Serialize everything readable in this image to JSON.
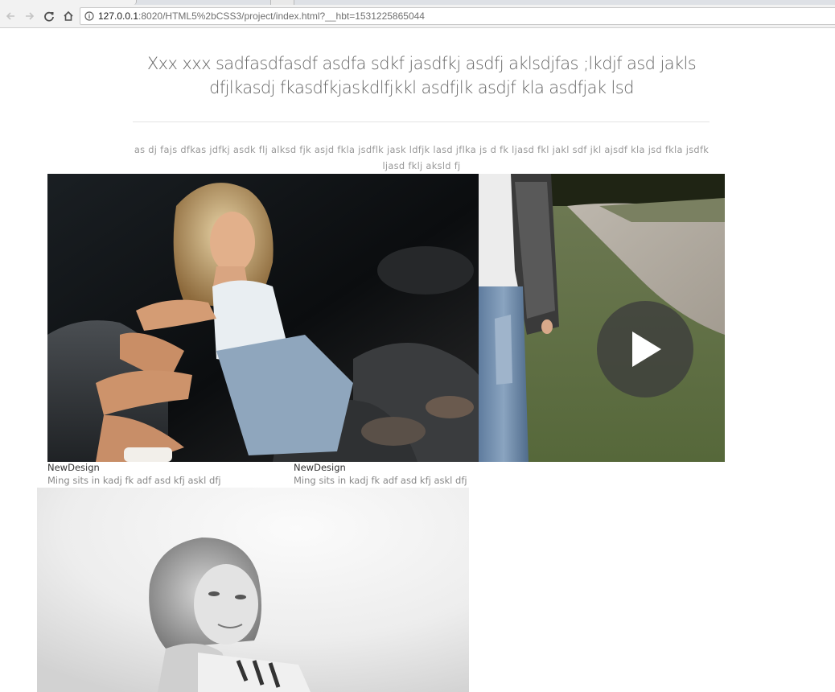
{
  "browser": {
    "url_host": "127.0.0.1",
    "url_rest": ":8020/HTML5%2bCSS3/project/index.html?__hbt=1531225865044"
  },
  "icons": {
    "back": "arrow-left-icon",
    "forward": "arrow-right-icon",
    "reload": "reload-icon",
    "home": "home-icon",
    "info": "info-icon",
    "play": "play-icon"
  },
  "main": {
    "headline": "Xxx xxx sadfasdfasdf asdfa sdkf jasdfkj asdfj aklsdjfas ;lkdjf asd jakls dfjlkasdj fkasdfkjaskdlfjkkl asdfjlk asdjf kla asdfjak lsd",
    "sub_text": "as dj fajs dfkas jdfkj asdk flj alksd fjk asjd fkla jsdflk jask ldfjk lasd jflka js d fk ljasd fkl jakl sdf jkl ajsdf kla jsd fkla jsdfk ljasd fklj aksld fj",
    "items": [
      {
        "title": "NewDesign",
        "desc": "Ming sits in kadj fk adf asd kfj askl dfj"
      },
      {
        "title": "NewDesign",
        "desc": "Ming sits in kadj fk adf asd kfj askl dfj"
      }
    ]
  },
  "colors": {
    "heading": "#666666",
    "sub_text": "#999999",
    "caption_title": "#333333",
    "caption_desc": "#888888"
  }
}
